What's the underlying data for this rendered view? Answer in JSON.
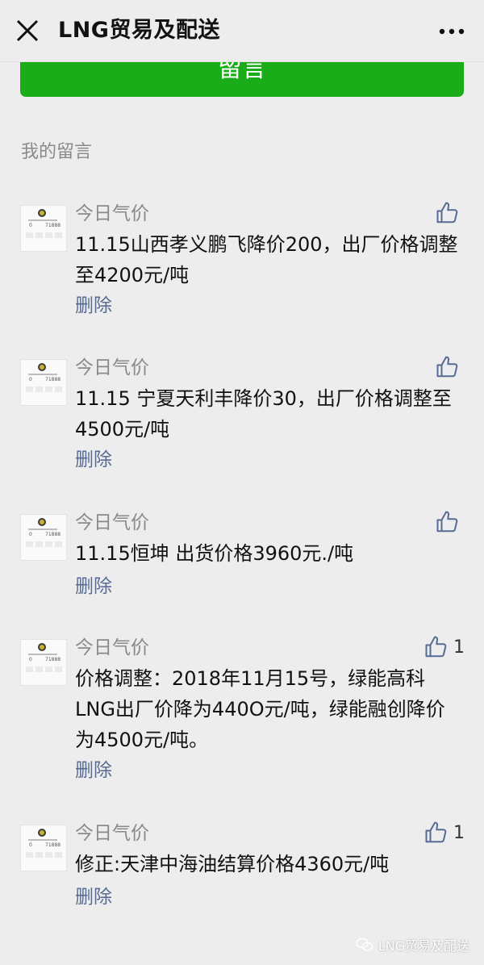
{
  "header": {
    "title": "LNG贸易及配送"
  },
  "primary_button": {
    "label": "留言"
  },
  "section": {
    "title": "我的留言"
  },
  "comments": [
    {
      "nickname": "今日气价",
      "text": "11.15山西孝义鹏飞降价200，出厂价格调整至4200元/吨",
      "delete_label": "删除",
      "like_count": ""
    },
    {
      "nickname": "今日气价",
      "text": "11.15 宁夏天利丰降价30，出厂价格调整至4500元/吨",
      "delete_label": "删除",
      "like_count": ""
    },
    {
      "nickname": "今日气价",
      "text": "11.15恒坤 出货价格3960元./吨",
      "delete_label": "删除",
      "like_count": ""
    },
    {
      "nickname": "今日气价",
      "text": "价格调整：2018年11月15号，绿能高科LNG出厂价降为440O元/吨，绿能融创降价为4500元/吨。",
      "delete_label": "删除",
      "like_count": "1"
    },
    {
      "nickname": "今日气价",
      "text": "修正:天津中海油结算价格4360元/吨",
      "delete_label": "删除",
      "like_count": "1"
    }
  ],
  "avatar": {
    "number_left": "0",
    "number_right": "71888"
  },
  "watermark": {
    "text": "LNG贸易及配送"
  },
  "colors": {
    "accent_green": "#1aad19",
    "link_blue": "#576b95",
    "background": "#ededed"
  }
}
